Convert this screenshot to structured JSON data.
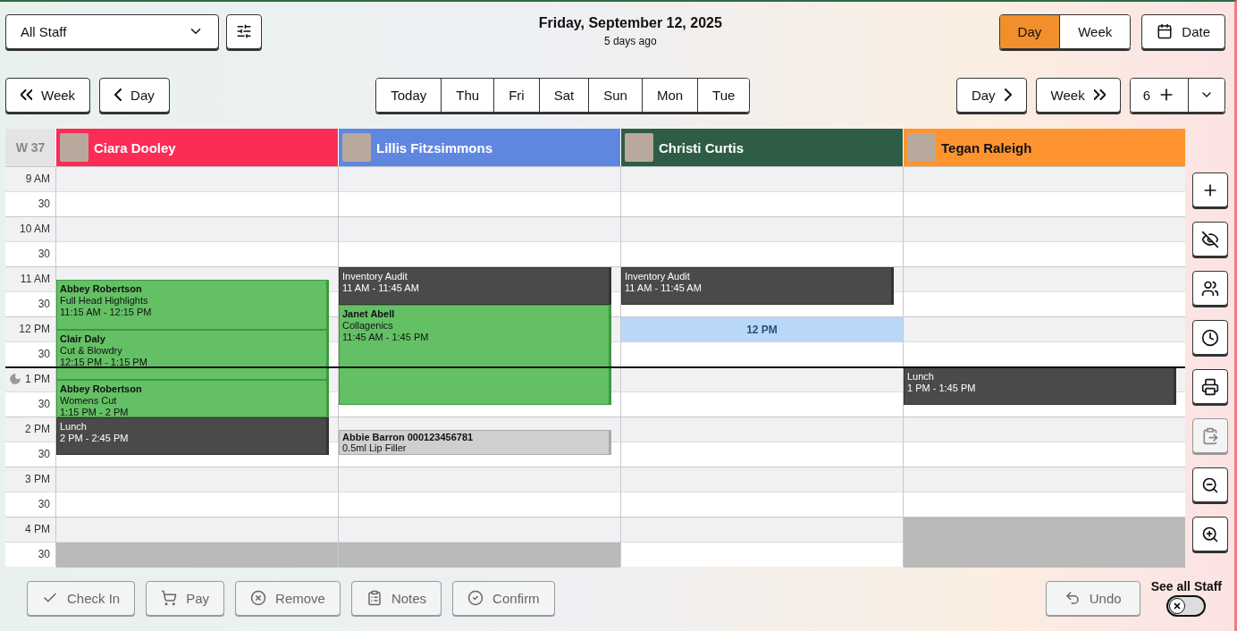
{
  "staff_filter": {
    "value": "All Staff"
  },
  "date_heading": {
    "title": "Friday, September 12, 2025",
    "subtitle": "5 days ago"
  },
  "view_toggle": [
    {
      "label": "Day",
      "selected": true
    },
    {
      "label": "Week",
      "selected": false
    }
  ],
  "date_button": "Date",
  "nav_back": [
    {
      "label": "Week",
      "kind": "double"
    },
    {
      "label": "Day",
      "kind": "single"
    }
  ],
  "day_tabs": [
    {
      "label": "Today"
    },
    {
      "label": "Thu"
    },
    {
      "label": "Fri"
    },
    {
      "label": "Sat"
    },
    {
      "label": "Sun"
    },
    {
      "label": "Mon"
    },
    {
      "label": "Tue"
    }
  ],
  "nav_forward": [
    {
      "label": "Day",
      "kind": "single"
    },
    {
      "label": "Week",
      "kind": "double"
    }
  ],
  "column_count": {
    "value": "6"
  },
  "week_label": "W 37",
  "time_labels": [
    {
      "text": "9 AM",
      "moon": false
    },
    {
      "text": "30",
      "moon": false
    },
    {
      "text": "10 AM",
      "moon": false
    },
    {
      "text": "30",
      "moon": false
    },
    {
      "text": "11 AM",
      "moon": false
    },
    {
      "text": "30",
      "moon": false
    },
    {
      "text": "12 PM",
      "moon": false
    },
    {
      "text": "30",
      "moon": false
    },
    {
      "text": "1 PM",
      "moon": true
    },
    {
      "text": "30",
      "moon": false
    },
    {
      "text": "2 PM",
      "moon": false
    },
    {
      "text": "30",
      "moon": false
    },
    {
      "text": "3 PM",
      "moon": false
    },
    {
      "text": "30",
      "moon": false
    },
    {
      "text": "4 PM",
      "moon": false
    },
    {
      "text": "30",
      "moon": false
    }
  ],
  "staff": [
    {
      "name": "Ciara Dooley",
      "color": "#fb2c55",
      "events": [
        {
          "kind": "appointment",
          "client": "Abbey Robertson",
          "service": "Full Head Highlights",
          "time": "11:15 AM - 12:15 PM"
        },
        {
          "kind": "appointment",
          "client": "Clair Daly",
          "service": "Cut & Blowdry",
          "time": "12:15 PM - 1:15 PM"
        },
        {
          "kind": "appointment",
          "client": "Abbey Robertson",
          "service": "Womens Cut",
          "time": "1:15 PM - 2 PM"
        },
        {
          "kind": "block",
          "title": "Lunch",
          "time": "2 PM - 2:45 PM"
        },
        {
          "kind": "unavailable"
        }
      ]
    },
    {
      "name": "Lillis Fitzsimmons",
      "color": "#5f87e0",
      "events": [
        {
          "kind": "block",
          "title": "Inventory Audit",
          "time": "11 AM - 11:45 AM"
        },
        {
          "kind": "appointment",
          "client": "Janet Abell",
          "service": "Collagenics",
          "time": "11:45 AM - 1:45 PM"
        },
        {
          "kind": "pending",
          "client": "Abbie Barron 000123456781",
          "service": "0.5ml Lip Filler"
        },
        {
          "kind": "unavailable"
        }
      ]
    },
    {
      "name": "Christi Curtis",
      "color": "#2d5e45",
      "events": [
        {
          "kind": "block",
          "title": "Inventory Audit",
          "time": "11 AM - 11:45 AM"
        },
        {
          "kind": "selection",
          "label": "12 PM"
        }
      ]
    },
    {
      "name": "Tegan Raleigh",
      "color": "#fd9430",
      "events": [
        {
          "kind": "block",
          "title": "Lunch",
          "time": "1 PM - 1:45 PM"
        },
        {
          "kind": "unavailable"
        }
      ]
    }
  ],
  "side_tools": [
    {
      "kind": "add",
      "disabled": false
    },
    {
      "kind": "hide",
      "disabled": false
    },
    {
      "kind": "group",
      "disabled": false
    },
    {
      "kind": "clock",
      "disabled": false
    },
    {
      "kind": "print",
      "disabled": false
    },
    {
      "kind": "paste",
      "disabled": true
    },
    {
      "kind": "zoom-out",
      "disabled": false
    },
    {
      "kind": "zoom-in",
      "disabled": false
    }
  ],
  "actions": [
    {
      "label": "Check In",
      "kind": "check",
      "disabled": true
    },
    {
      "label": "Pay",
      "kind": "pay",
      "disabled": true
    },
    {
      "label": "Remove",
      "kind": "remove",
      "disabled": true
    },
    {
      "label": "Notes",
      "kind": "notes",
      "disabled": true
    },
    {
      "label": "Confirm",
      "kind": "confirm",
      "disabled": true
    }
  ],
  "undo": {
    "label": "Undo",
    "disabled": true
  },
  "see_all_staff": {
    "label": "See all Staff",
    "on": false
  }
}
